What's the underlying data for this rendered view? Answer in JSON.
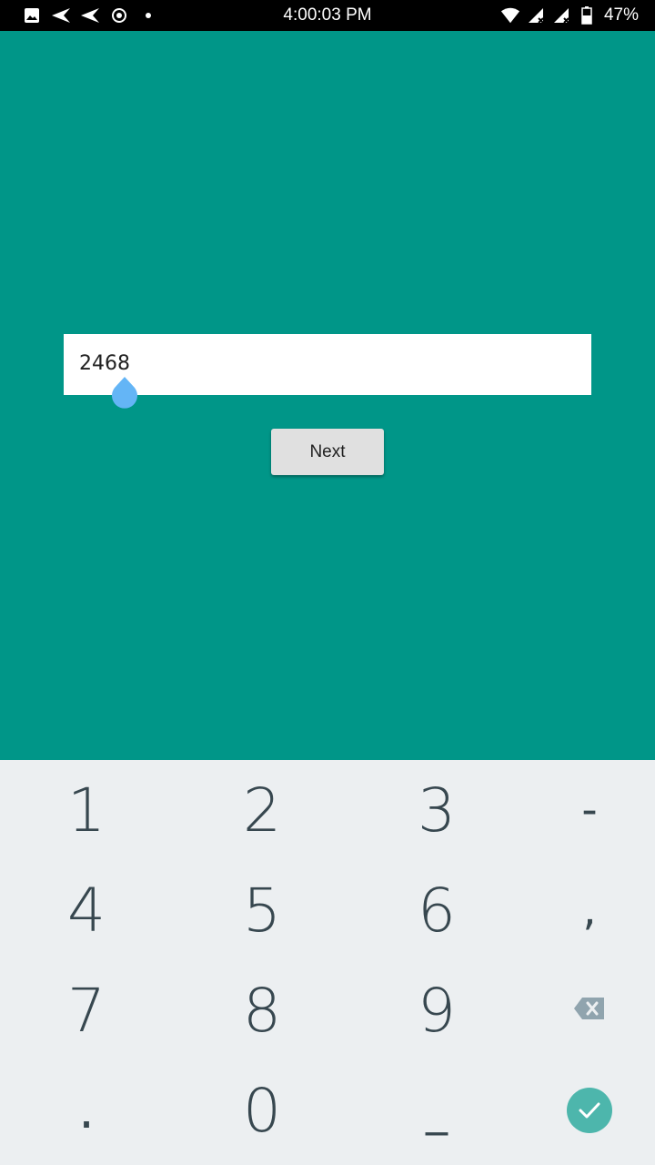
{
  "status_bar": {
    "time": "4:00:03 PM",
    "battery": "47%",
    "icons_left": [
      "image-icon",
      "send-icon",
      "send-icon",
      "record-icon",
      "dot-icon"
    ],
    "icons_right": [
      "wifi-icon",
      "signal-icon",
      "signal-roaming-icon",
      "battery-icon"
    ]
  },
  "form": {
    "input_value": "2468",
    "next_label": "Next"
  },
  "keyboard": {
    "row1": [
      "1",
      "2",
      "3",
      "-"
    ],
    "row2": [
      "4",
      "5",
      "6",
      ","
    ],
    "row3": [
      "7",
      "8",
      "9"
    ],
    "row4": [
      ".",
      "0",
      "_"
    ],
    "backspace_icon": "backspace-icon",
    "done_icon": "check-icon"
  },
  "colors": {
    "background": "#009688",
    "keyboard_bg": "#eceff1",
    "key_text": "#37474f",
    "accent": "#4db6ac",
    "cursor_handle": "#64b5f6"
  }
}
